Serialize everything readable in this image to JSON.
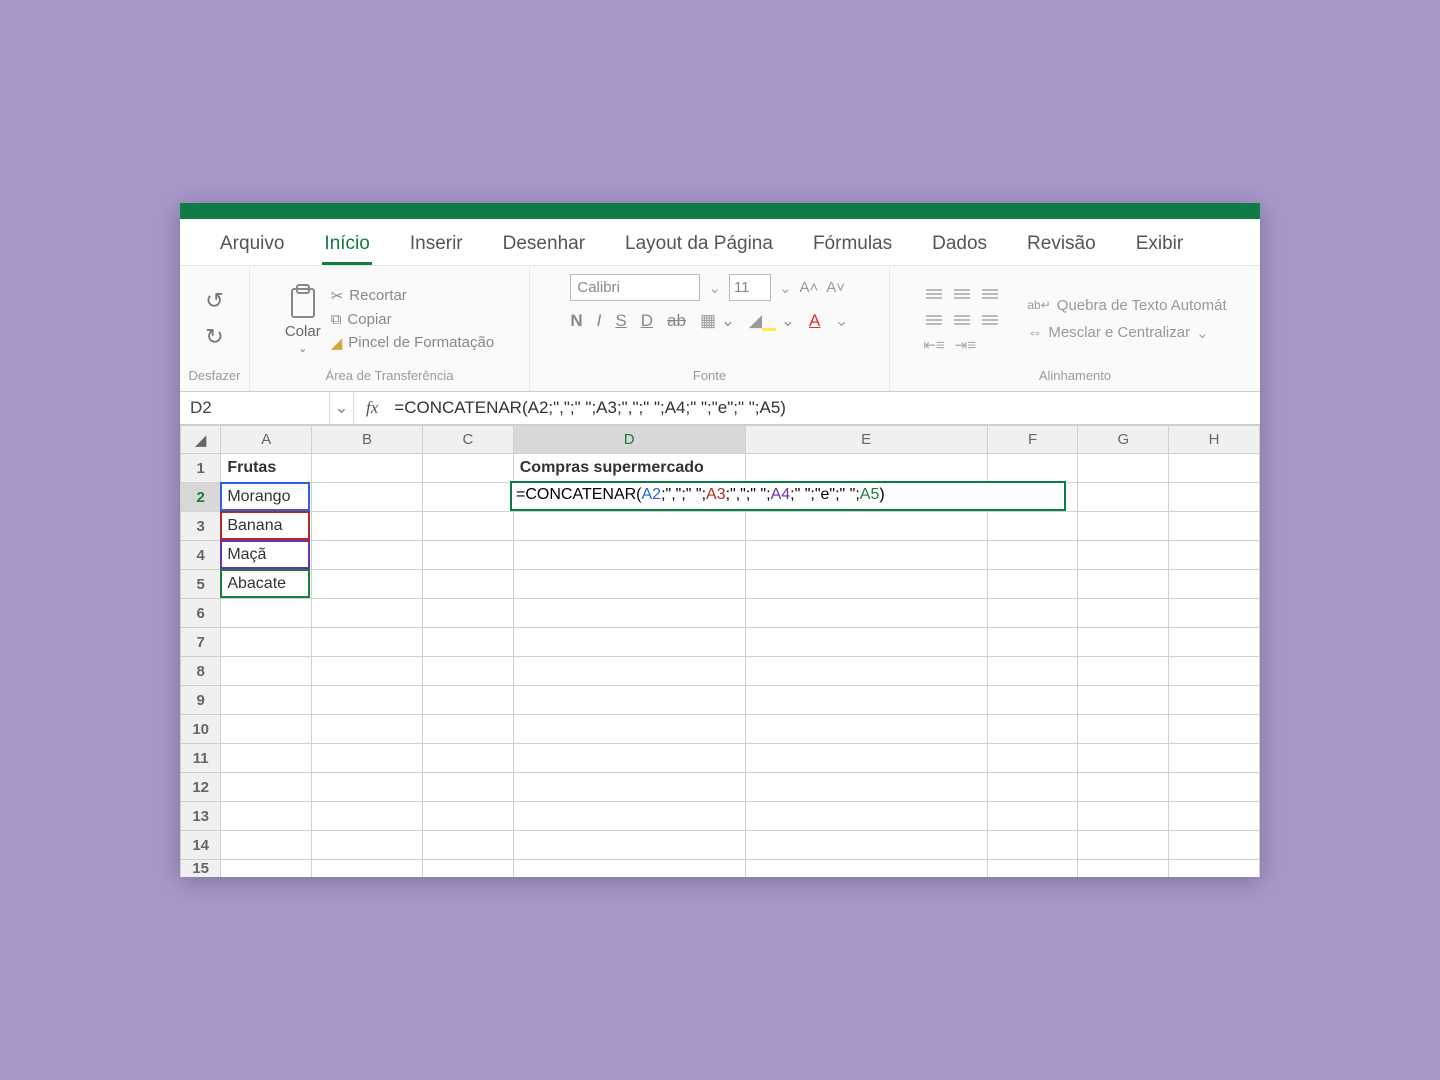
{
  "menu": {
    "items": [
      "Arquivo",
      "Início",
      "Inserir",
      "Desenhar",
      "Layout da Página",
      "Fórmulas",
      "Dados",
      "Revisão",
      "Exibir"
    ],
    "active_index": 1
  },
  "ribbon": {
    "undo_group": "Desfazer",
    "paste_label": "Colar",
    "cut": "Recortar",
    "copy": "Copiar",
    "format_painter": "Pincel de Formatação",
    "clipboard_group": "Área de Transferência",
    "font_name": "Calibri",
    "font_size": "11",
    "grow": "A˄",
    "shrink": "A˅",
    "bold": "N",
    "italic": "I",
    "underline": "S",
    "dunder": "D",
    "strike": "ab",
    "font_group": "Fonte",
    "wrap": "Quebra de Texto Automát",
    "merge": "Mesclar e Centralizar",
    "align_group": "Alinhamento"
  },
  "formula_bar": {
    "name_box": "D2",
    "fx": "fx",
    "formula": "=CONCATENAR(A2;\",\";\" \";A3;\",\";\" \";A4;\" \";\"e\";\" \";A5)"
  },
  "columns": [
    "A",
    "B",
    "C",
    "D",
    "E",
    "F",
    "G",
    "H"
  ],
  "rows": [
    1,
    2,
    3,
    4,
    5,
    6,
    7,
    8,
    9,
    10,
    11,
    12,
    13,
    14,
    15
  ],
  "cells": {
    "A1": "Frutas",
    "A2": "Morango",
    "A3": "Banana",
    "A4": "Maçã",
    "A5": "Abacate",
    "D1": "Compras supermercado"
  },
  "editing": {
    "prefix": "=CONCATENAR(",
    "a2": "A2",
    "sep1": ";\",\";\" \";",
    "a3": "A3",
    "sep2": ";\",\";\" \";",
    "a4": "A4",
    "sep3": ";\" \";\"e\";\" \";",
    "a5": "A5",
    "suffix": ")"
  }
}
